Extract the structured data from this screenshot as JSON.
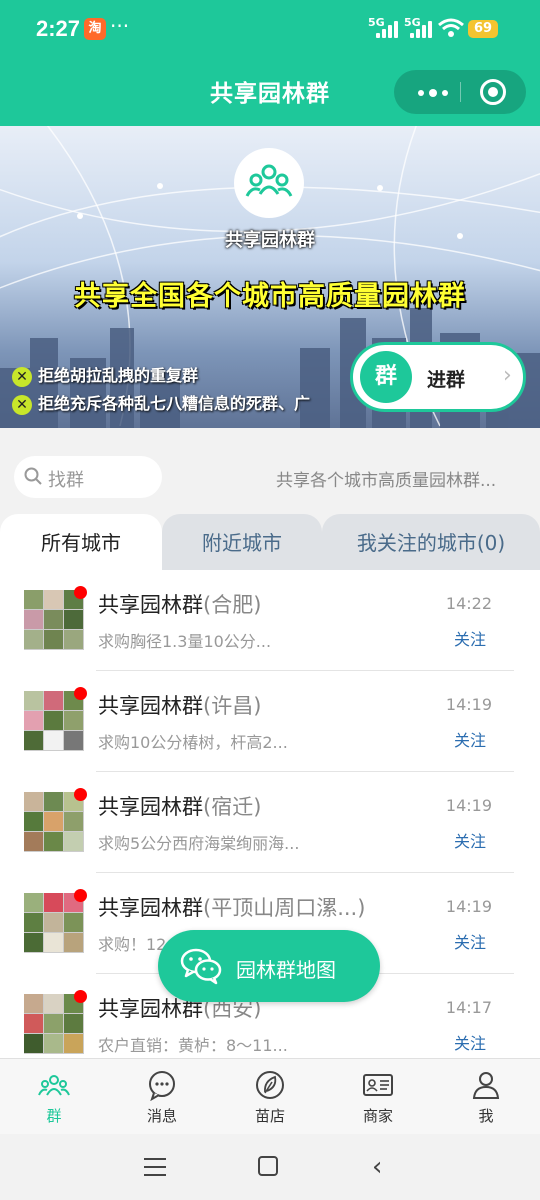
{
  "status_bar": {
    "time": "2:27",
    "app_badge": "淘",
    "more": "···",
    "network_1": "5G",
    "network_2": "5G",
    "battery": "69"
  },
  "nav": {
    "title": "共享园林群"
  },
  "banner": {
    "name": "共享园林群",
    "slogan": "共享全国各个城市高质量园林群",
    "rules": [
      "拒绝胡拉乱拽的重复群",
      "拒绝充斥各种乱七八糟信息的死群、广"
    ],
    "join_badge": "群",
    "join_label": "进群"
  },
  "search": {
    "placeholder": "找群",
    "marquee": "共享各个城市高质量园林群..."
  },
  "tabs": [
    "所有城市",
    "附近城市",
    "我关注的城市(0)"
  ],
  "groups": [
    {
      "name": "共享园林群",
      "city": "(合肥)",
      "message": "求购胸径1.3量10公分...",
      "time": "14:22",
      "action": "关注"
    },
    {
      "name": "共享园林群",
      "city": "(许昌)",
      "message": "求购10公分椿树，杆高2...",
      "time": "14:19",
      "action": "关注"
    },
    {
      "name": "共享园林群",
      "city": "(宿迁)",
      "message": "求购5公分西府海棠绚丽海...",
      "time": "14:19",
      "action": "关注"
    },
    {
      "name": "共享园林群",
      "city": "(平顶山周口漯...)",
      "message": "求购！12",
      "time": "14:19",
      "action": "关注"
    },
    {
      "name": "共享园林群",
      "city": "(西安)",
      "message": "农户直销：黄栌：8～11...",
      "time": "14:17",
      "action": "关注"
    }
  ],
  "map_button": {
    "label": "园林群地图"
  },
  "tabbar": [
    {
      "label": "群",
      "icon": "group-icon",
      "active": true
    },
    {
      "label": "消息",
      "icon": "message-icon",
      "active": false
    },
    {
      "label": "苗店",
      "icon": "leaf-icon",
      "active": false
    },
    {
      "label": "商家",
      "icon": "merchant-card-icon",
      "active": false
    },
    {
      "label": "我",
      "icon": "person-icon",
      "active": false
    }
  ],
  "colors": {
    "brand": "#1ec89a",
    "link": "#2b6db0",
    "slogan": "#ffff33",
    "unread": "#ff0000"
  }
}
